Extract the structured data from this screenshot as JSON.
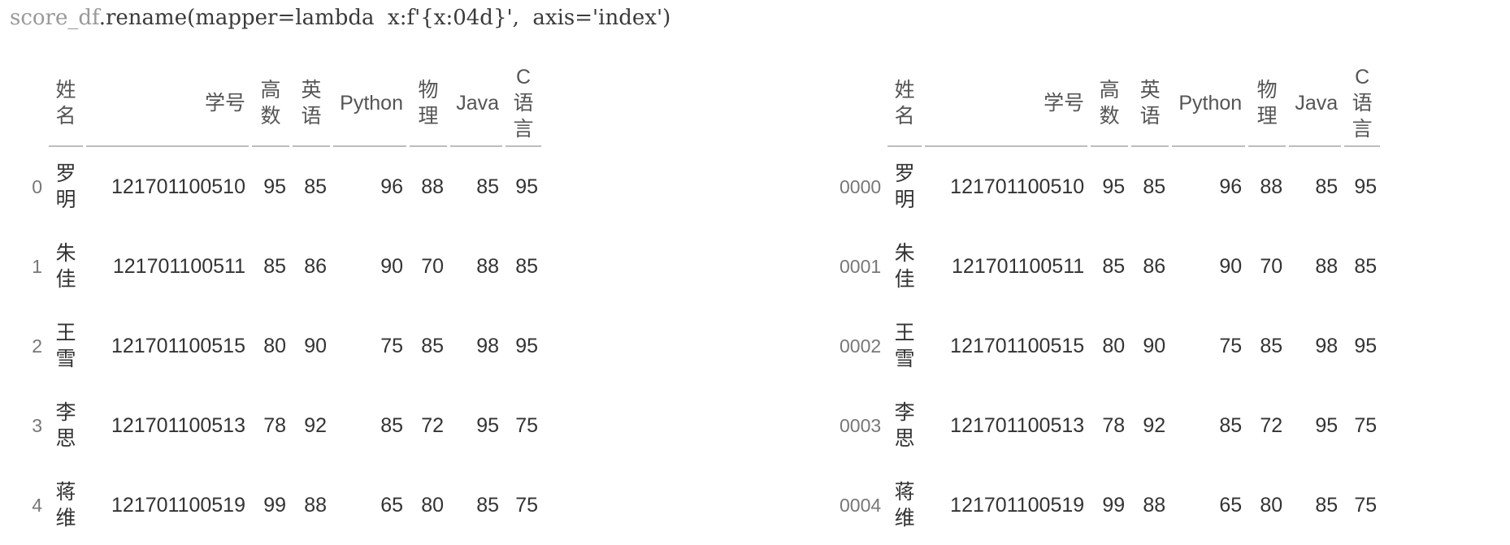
{
  "code": {
    "var": "score_df",
    "rest": ".rename(mapper=lambda  x:f'{x:04d}',  axis='index')"
  },
  "columns": [
    [
      "姓",
      "名"
    ],
    [
      "学号"
    ],
    [
      "高",
      "数"
    ],
    [
      "英",
      "语"
    ],
    [
      "Python"
    ],
    [
      "物",
      "理"
    ],
    [
      "Java"
    ],
    [
      "C",
      "语",
      "言"
    ]
  ],
  "rows": [
    {
      "name": [
        "罗",
        "明"
      ],
      "id": "121701100510",
      "vals": [
        "95",
        "85",
        "96",
        "88",
        "85",
        "95"
      ]
    },
    {
      "name": [
        "朱",
        "佳"
      ],
      "id": "121701100511",
      "vals": [
        "85",
        "86",
        "90",
        "70",
        "88",
        "85"
      ]
    },
    {
      "name": [
        "王",
        "雪"
      ],
      "id": "121701100515",
      "vals": [
        "80",
        "90",
        "75",
        "85",
        "98",
        "95"
      ]
    },
    {
      "name": [
        "李",
        "思"
      ],
      "id": "121701100513",
      "vals": [
        "78",
        "92",
        "85",
        "72",
        "95",
        "75"
      ]
    },
    {
      "name": [
        "蒋",
        "维"
      ],
      "id": "121701100519",
      "vals": [
        "99",
        "88",
        "65",
        "80",
        "85",
        "75"
      ]
    }
  ],
  "left_index": [
    "0",
    "1",
    "2",
    "3",
    "4"
  ],
  "right_index": [
    "0000",
    "0001",
    "0002",
    "0003",
    "0004"
  ]
}
